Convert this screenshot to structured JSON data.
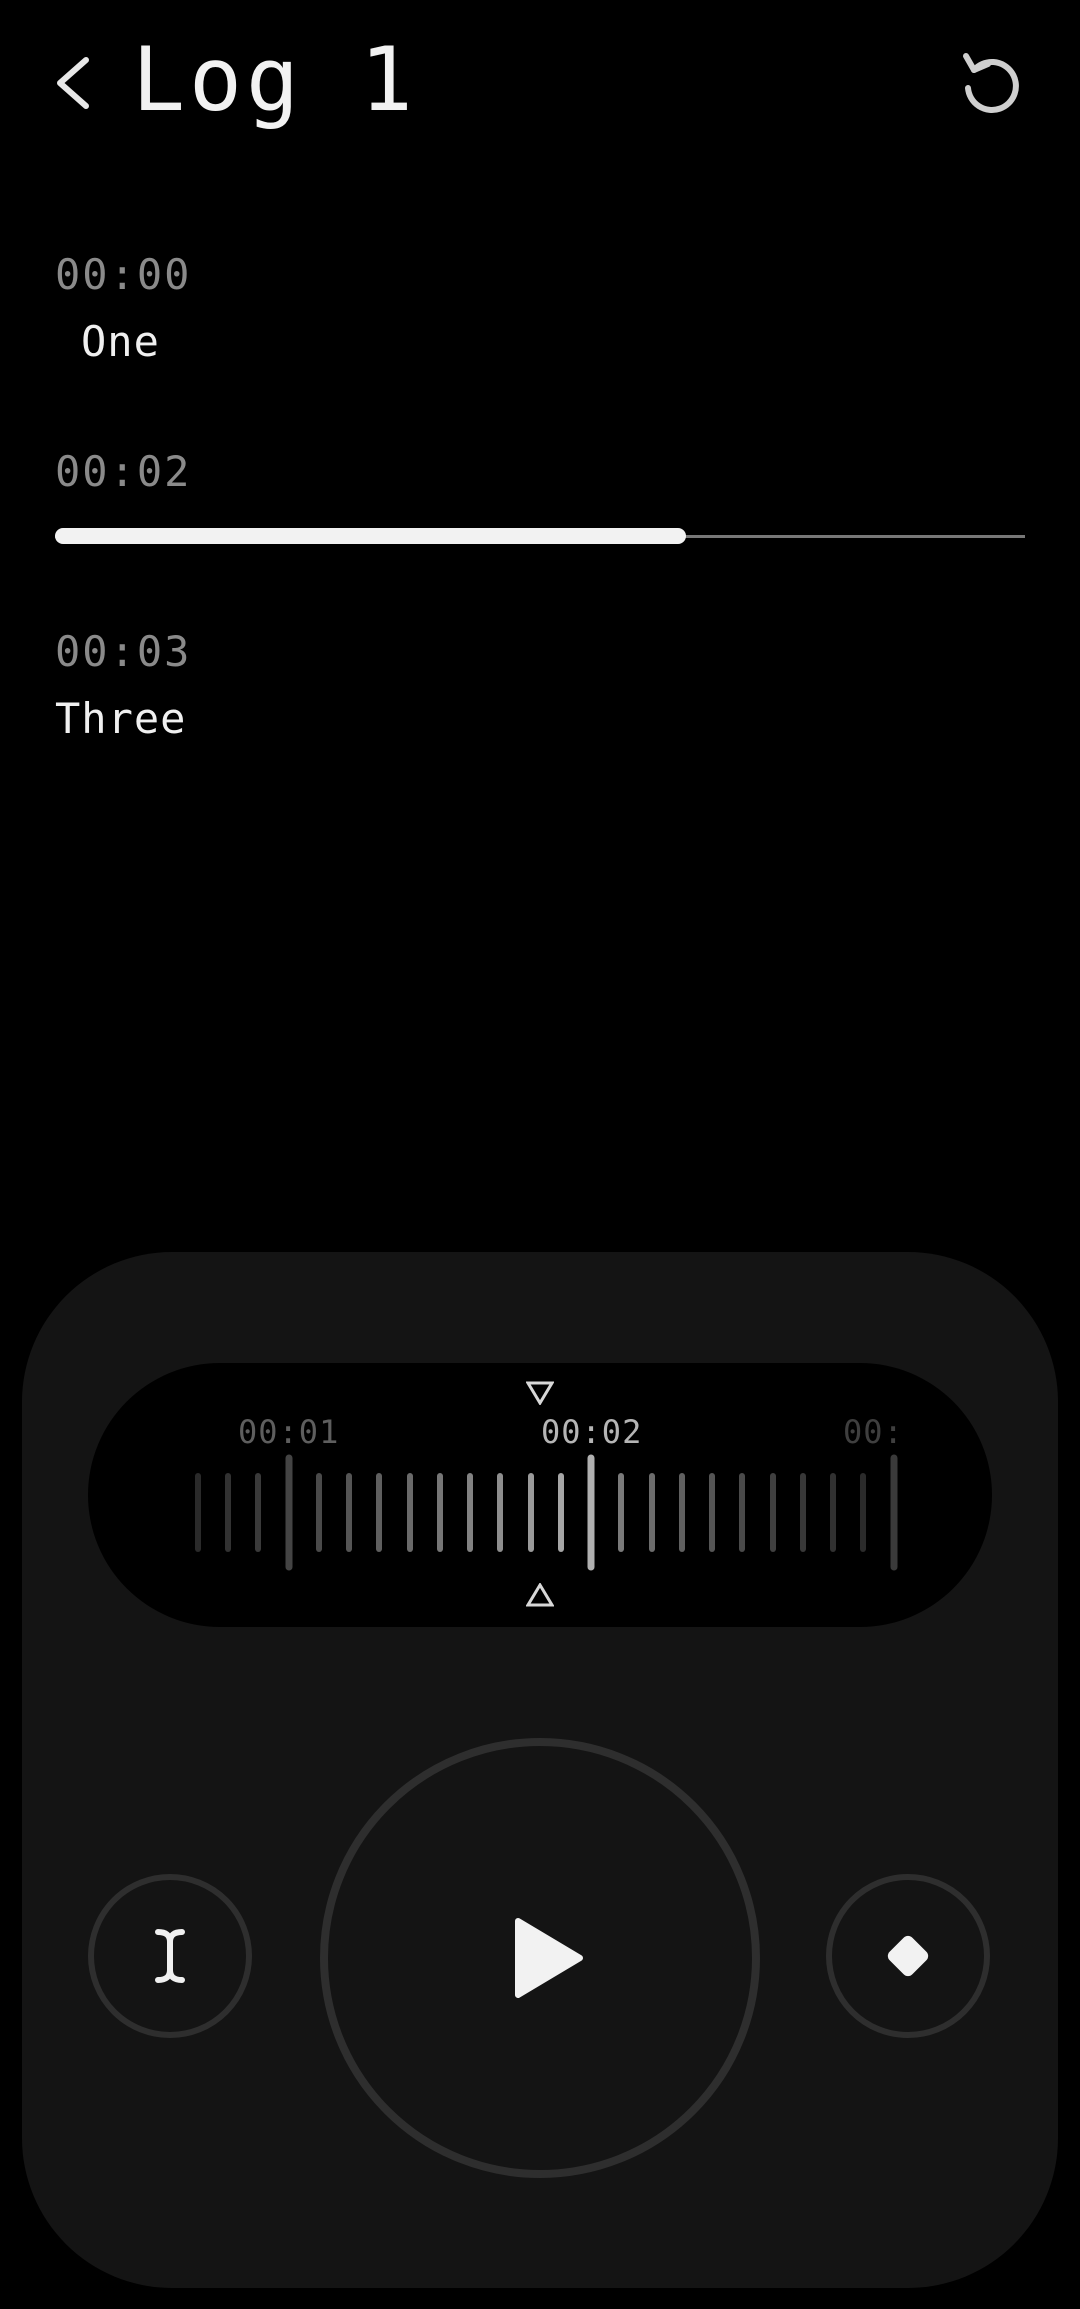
{
  "header": {
    "title": "Log 1",
    "back_icon": "chevron-left-icon",
    "reset_icon": "restart-icon"
  },
  "entries": [
    {
      "timestamp": "00:00",
      "label": "One"
    },
    {
      "timestamp": "00:02",
      "label": "",
      "progress": 0.65
    },
    {
      "timestamp": "00:03",
      "label": "Three"
    }
  ],
  "scrubber": {
    "ticks_labels": [
      "00:01",
      "00:02",
      "00:"
    ],
    "current": "00:02"
  },
  "controls": {
    "text_cursor_icon": "text-cursor-icon",
    "play_icon": "play-icon",
    "marker_icon": "diamond-icon"
  },
  "colors": {
    "background": "#000000",
    "panel": "#141414",
    "accent": "#f2f2f2",
    "muted": "#8a8a8a"
  }
}
